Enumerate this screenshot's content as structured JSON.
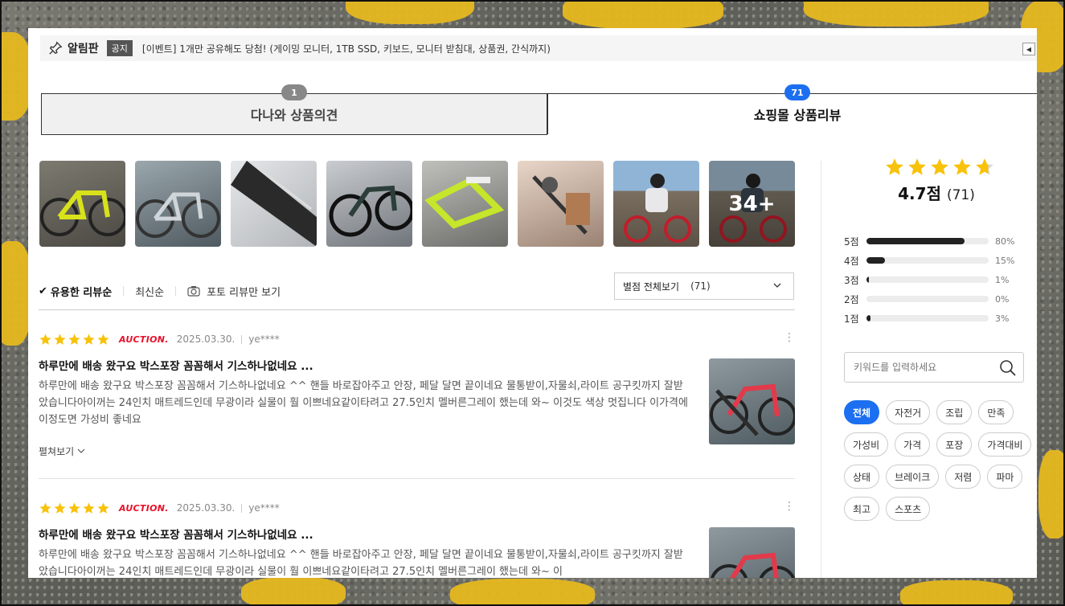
{
  "notice": {
    "title": "알림판",
    "badge": "공지",
    "text": "[이벤트] 1개만 공유해도 당첨! (게이밍 모니터, 1TB SSD, 키보드, 모니터 받침대, 상품권, 간식까지)"
  },
  "tabs": [
    {
      "label": "다나와 상품의견",
      "count": "1"
    },
    {
      "label": "쇼핑몰 상품리뷰",
      "count": "71"
    }
  ],
  "photos": {
    "more_label": "34+",
    "items": [
      "bike-yellow",
      "bike-gray",
      "bike-frame-closeup",
      "bike-dark",
      "bike-lime",
      "bike-parts",
      "child-riding",
      "child-riding-2"
    ]
  },
  "sort": {
    "options": [
      "유용한 리뷰순",
      "최신순"
    ],
    "photo_only": "포토 리뷰만 보기",
    "filter_label": "별점 전체보기",
    "filter_count": "(71)"
  },
  "reviews": [
    {
      "rating": 5,
      "mall": "AUCTION.",
      "date": "2025.03.30.",
      "user": "ye****",
      "title": "하루만에 배송 왔구요 박스포장 꼼꼼해서 기스하나없네요 ...",
      "body": "하루만에 배송 왔구요 박스포장 꼼꼼해서 기스하나없네요 ^^ 핸들 바로잡아주고 안장, 페달 달면 끝이네요 물통받이,자물쇠,라이트 공구킷까지 잘받았습니다아이꺼는 24인치 매트레드인데 무광이라 실물이 훨 이쁘네요같이타려고 27.5인치 멜버른그레이 했는데 와~ 이것도 색상 멋집니다 이가격에 이정도면 가성비 좋네요",
      "more": "펼쳐보기"
    },
    {
      "rating": 5,
      "mall": "AUCTION.",
      "date": "2025.03.30.",
      "user": "ye****",
      "title": "하루만에 배송 왔구요 박스포장 꼼꼼해서 기스하나없네요 ...",
      "body": "하루만에 배송 왔구요 박스포장 꼼꼼해서 기스하나없네요 ^^ 핸들 바로잡아주고 안장, 페달 달면 끝이네요 물통받이,자물쇠,라이트 공구킷까지 잘받았습니다아이꺼는 24인치 매트레드인데 무광이라 실물이 훨 이쁘네요같이타려고 27.5인치 멜버른그레이 했는데 와~ 이",
      "more": ""
    }
  ],
  "summary": {
    "score": "4.7점",
    "count": "(71)",
    "rating_fraction": 0.94,
    "distribution": [
      {
        "label": "5점",
        "pct": "80%",
        "value": 80
      },
      {
        "label": "4점",
        "pct": "15%",
        "value": 15
      },
      {
        "label": "3점",
        "pct": "1%",
        "value": 1
      },
      {
        "label": "2점",
        "pct": "0%",
        "value": 0
      },
      {
        "label": "1점",
        "pct": "3%",
        "value": 3
      }
    ]
  },
  "search": {
    "placeholder": "키워드를 입력하세요"
  },
  "tags": [
    "전체",
    "자전거",
    "조립",
    "만족",
    "가성비",
    "가격",
    "포장",
    "가격대비",
    "상태",
    "브레이크",
    "저렴",
    "파마",
    "최고",
    "스포츠"
  ],
  "colors": {
    "accent": "#1b6ff0",
    "star": "#f8c20a",
    "mall": "#e8102a"
  }
}
